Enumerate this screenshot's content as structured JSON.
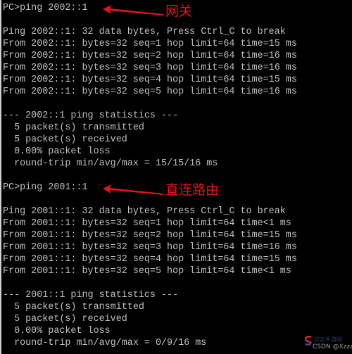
{
  "block1": {
    "prompt": "PC>ping 2002::1",
    "annotation": "网关",
    "header": "Ping 2002::1: 32 data bytes, Press Ctrl_C to break",
    "replies": [
      "From 2002::1: bytes=32 seq=1 hop limit=64 time=15 ms",
      "From 2002::1: bytes=32 seq=2 hop limit=64 time=16 ms",
      "From 2002::1: bytes=32 seq=3 hop limit=64 time=16 ms",
      "From 2002::1: bytes=32 seq=4 hop limit=64 time=15 ms",
      "From 2002::1: bytes=32 seq=5 hop limit=64 time=16 ms"
    ],
    "stats_title": "--- 2002::1 ping statistics ---",
    "stats": [
      "  5 packet(s) transmitted",
      "  5 packet(s) received",
      "  0.00% packet loss",
      "  round-trip min/avg/max = 15/15/16 ms"
    ]
  },
  "block2": {
    "prompt": "PC>ping 2001::1",
    "annotation": "直连路由",
    "header": "Ping 2001::1: 32 data bytes, Press Ctrl_C to break",
    "replies": [
      "From 2001::1: bytes=32 seq=1 hop limit=64 time<1 ms",
      "From 2001::1: bytes=32 seq=2 hop limit=64 time=15 ms",
      "From 2001::1: bytes=32 seq=3 hop limit=64 time=16 ms",
      "From 2001::1: bytes=32 seq=4 hop limit=64 time=15 ms",
      "From 2001::1: bytes=32 seq=5 hop limit=64 time<1 ms"
    ],
    "stats_title": "--- 2001::1 ping statistics ---",
    "stats": [
      "  5 packet(s) transmitted",
      "  5 packet(s) received",
      "  0.00% packet loss",
      "  round-trip min/avg/max = 0/9/16 ms"
    ]
  },
  "watermark": {
    "line1": "华云手游网",
    "line2": "CSDN @Xzzz"
  },
  "colors": {
    "background": "#000000",
    "text": "#c0c0c0",
    "annotation": "#e0141a"
  }
}
